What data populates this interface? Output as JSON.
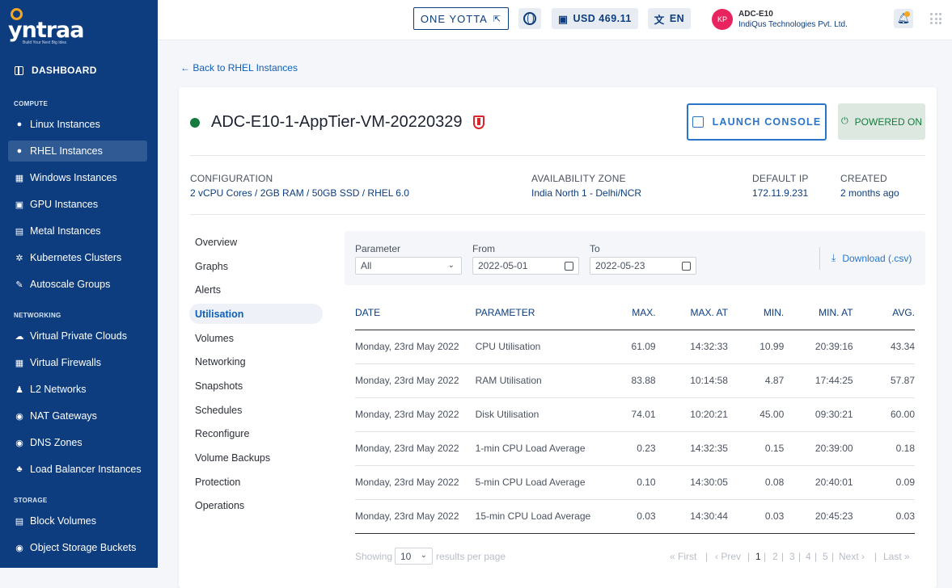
{
  "brand": {
    "logo_text": "yntraa",
    "tagline": "Build Your Next Big Idea"
  },
  "sidebar": {
    "dashboard": "DASHBOARD",
    "compute_heading": "COMPUTE",
    "compute": [
      "Linux Instances",
      "RHEL Instances",
      "Windows Instances",
      "GPU Instances",
      "Metal Instances",
      "Kubernetes Clusters",
      "Autoscale Groups"
    ],
    "networking_heading": "NETWORKING",
    "networking": [
      "Virtual Private Clouds",
      "Virtual Firewalls",
      "L2 Networks",
      "NAT Gateways",
      "DNS Zones",
      "Load Balancer Instances"
    ],
    "storage_heading": "STORAGE",
    "storage": [
      "Block Volumes",
      "Object Storage Buckets"
    ]
  },
  "topbar": {
    "one_yotta": "ONE YOTTA",
    "balance": "USD 469.11",
    "language": "EN",
    "user_initials": "KP",
    "user_name": "ADC-E10",
    "org": "IndiQus Technologies Pvt. Ltd."
  },
  "back_link": "Back to RHEL Instances",
  "vm": {
    "name": "ADC-E10-1-AppTier-VM-20220329",
    "launch_console": "LAUNCH CONSOLE",
    "power_state": "POWERED ON",
    "status_color": "#157a3e",
    "configuration_label": "CONFIGURATION",
    "configuration": "2 vCPU Cores / 2GB RAM / 50GB SSD / RHEL 6.0",
    "zone_label": "AVAILABILITY ZONE",
    "zone": "India North 1 - Delhi/NCR",
    "ip_label": "DEFAULT IP",
    "ip": "172.11.9.231",
    "created_label": "CREATED",
    "created": "2 months ago"
  },
  "subnav": [
    "Overview",
    "Graphs",
    "Alerts",
    "Utilisation",
    "Volumes",
    "Networking",
    "Snapshots",
    "Schedules",
    "Reconfigure",
    "Volume Backups",
    "Protection",
    "Operations"
  ],
  "filters": {
    "parameter_label": "Parameter",
    "parameter": "All",
    "from_label": "From",
    "from": "2022-05-01",
    "to_label": "To",
    "to": "2022-05-23",
    "download": "Download (.csv)"
  },
  "table": {
    "headers": [
      "DATE",
      "PARAMETER",
      "MAX.",
      "MAX. AT",
      "MIN.",
      "MIN. AT",
      "AVG."
    ],
    "rows": [
      [
        "Monday, 23rd May 2022",
        "CPU Utilisation",
        "61.09",
        "14:32:33",
        "10.99",
        "20:39:16",
        "43.34"
      ],
      [
        "Monday, 23rd May 2022",
        "RAM Utilisation",
        "83.88",
        "10:14:58",
        "4.87",
        "17:44:25",
        "57.87"
      ],
      [
        "Monday, 23rd May 2022",
        "Disk Utilisation",
        "74.01",
        "10:20:21",
        "45.00",
        "09:30:21",
        "60.00"
      ],
      [
        "Monday, 23rd May 2022",
        "1-min CPU Load Average",
        "0.23",
        "14:32:35",
        "0.15",
        "20:39:00",
        "0.18"
      ],
      [
        "Monday, 23rd May 2022",
        "5-min CPU Load Average",
        "0.10",
        "14:30:05",
        "0.08",
        "20:40:01",
        "0.09"
      ],
      [
        "Monday, 23rd May 2022",
        "15-min CPU Load Average",
        "0.03",
        "14:30:44",
        "0.03",
        "20:45:23",
        "0.03"
      ]
    ]
  },
  "pagination": {
    "showing": "Showing",
    "per_page": "10",
    "results_per_page": "results per page",
    "first": "« First",
    "prev": "‹ Prev",
    "pages": [
      "1",
      "2",
      "3",
      "4",
      "5"
    ],
    "next": "Next ›",
    "last": "Last »"
  }
}
